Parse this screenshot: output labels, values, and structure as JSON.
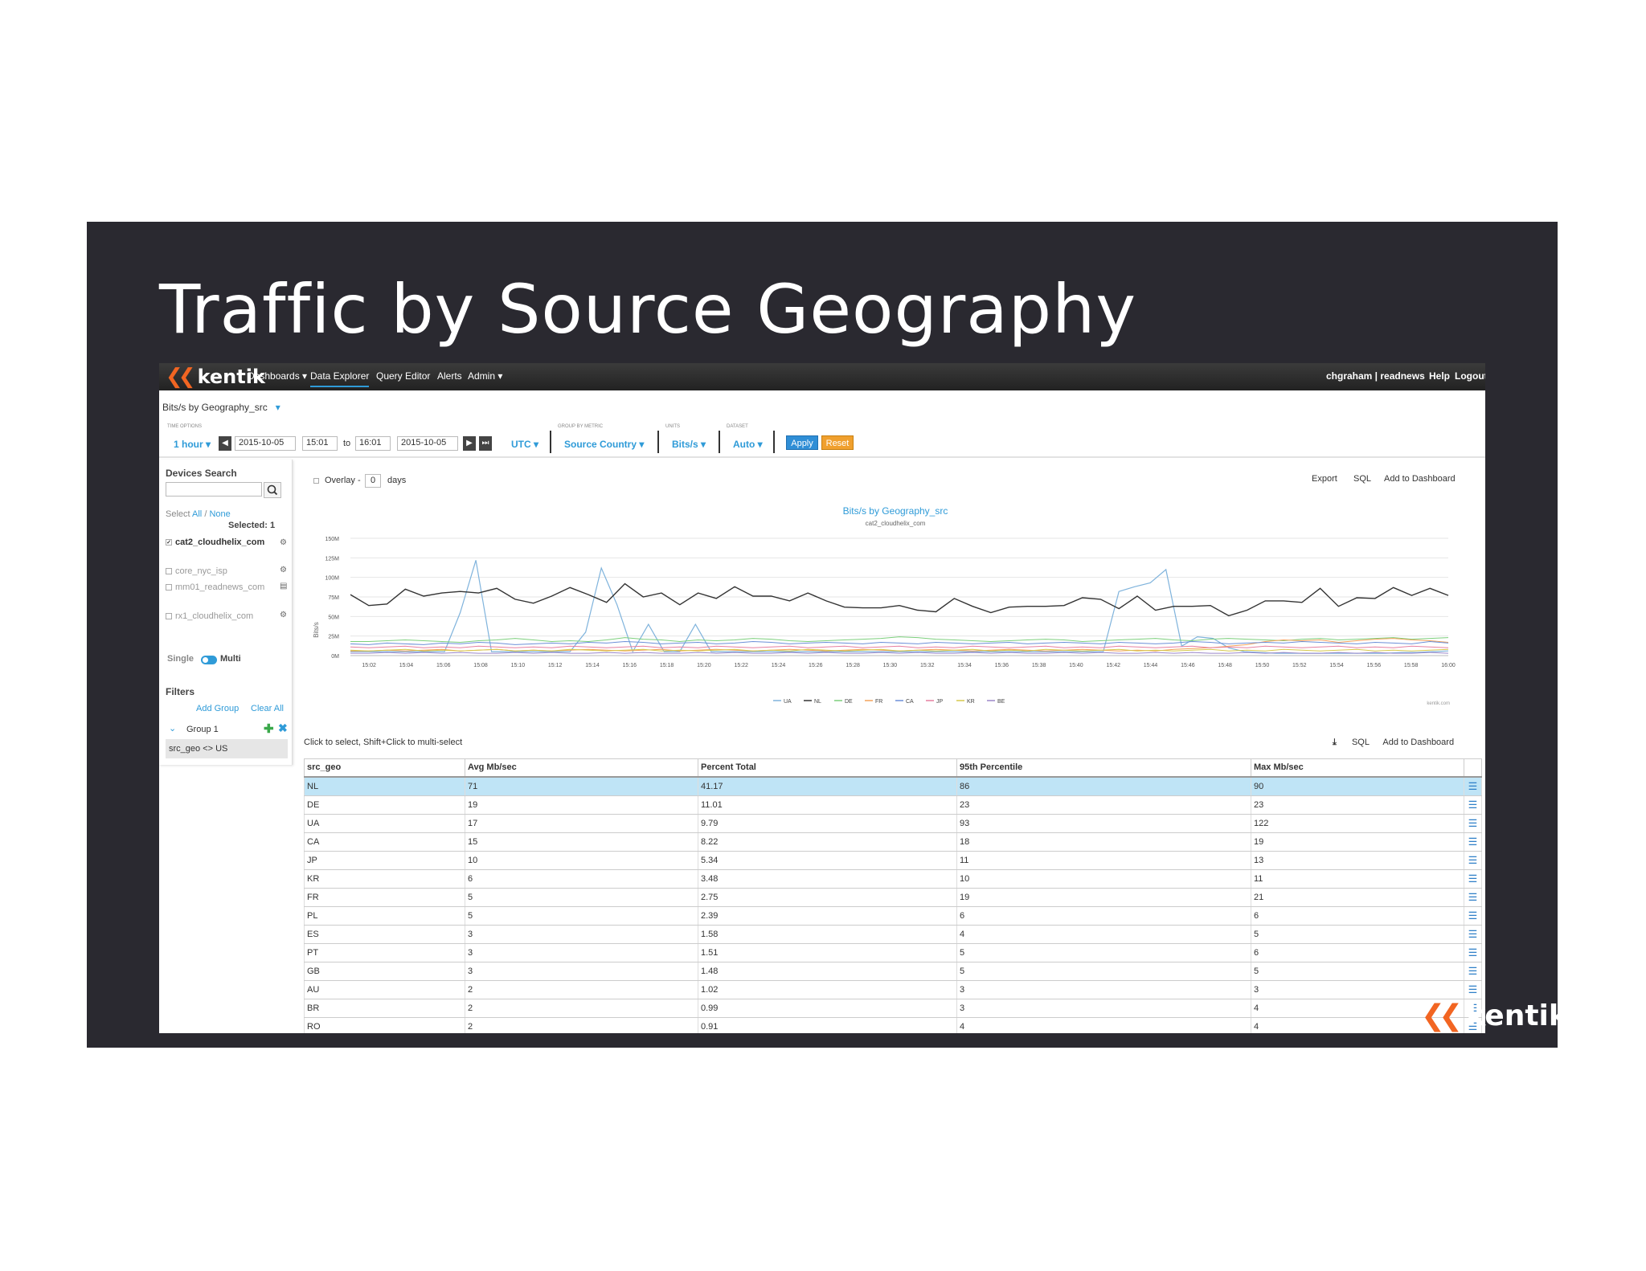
{
  "slide": {
    "title": "Traffic by Source Geography"
  },
  "navbar": {
    "logo": "kentik",
    "items": [
      "Dashboards",
      "Data Explorer",
      "Query Editor",
      "Alerts",
      "Admin"
    ],
    "user": "chgraham | readnews",
    "help": "Help",
    "logout": "Logout"
  },
  "query": {
    "title": "Bits/s by Geography_src",
    "time_options_label": "Time Options",
    "time_range": "1 hour",
    "start_date": "2015-10-05",
    "start_time": "15:01",
    "to_label": "to",
    "end_time": "16:01",
    "end_date": "2015-10-05",
    "timezone": "UTC",
    "group_by_label": "Group by Metric",
    "group_by": "Source Country",
    "units_label": "Units",
    "units": "Bits/s",
    "dataset_label": "Dataset",
    "dataset": "Auto",
    "apply": "Apply",
    "reset": "Reset"
  },
  "sidebar": {
    "devices_heading": "Devices Search",
    "select_label": "Select",
    "select_all": "All",
    "select_sep": "/",
    "select_none": "None",
    "selected": "Selected: 1",
    "devices": [
      {
        "name": "cat2_cloudhelix_com",
        "checked": true
      },
      {
        "name": "core_nyc_isp",
        "checked": false
      },
      {
        "name": "mm01_readnews_com",
        "checked": false
      },
      {
        "name": "rx1_cloudhelix_com",
        "checked": false
      }
    ],
    "mode_single": "Single",
    "mode_multi": "Multi",
    "filters_heading": "Filters",
    "add_group": "Add Group",
    "clear_all": "Clear All",
    "group_name": "Group 1",
    "filter_expr": "src_geo <> US"
  },
  "chart_panel": {
    "overlay_label": "Overlay -",
    "overlay_value": "0",
    "overlay_unit": "days",
    "export": "Export",
    "sql": "SQL",
    "add_to_dashboard": "Add to Dashboard",
    "credit": "kentik.com"
  },
  "chart_data": {
    "type": "line",
    "title": "Bits/s by Geography_src",
    "subtitle": "cat2_cloudhelix_com",
    "ylabel": "Bits/s",
    "xlabel": "",
    "ylim": [
      0,
      150
    ],
    "yticks": [
      0,
      25,
      50,
      75,
      100,
      125,
      150
    ],
    "ytick_labels": [
      "0M",
      "25M",
      "50M",
      "75M",
      "100M",
      "125M",
      "150M"
    ],
    "x_ticks": [
      "15:02",
      "15:04",
      "15:06",
      "15:08",
      "15:10",
      "15:12",
      "15:14",
      "15:16",
      "15:18",
      "15:20",
      "15:22",
      "15:24",
      "15:26",
      "15:28",
      "15:30",
      "15:32",
      "15:34",
      "15:36",
      "15:38",
      "15:40",
      "15:42",
      "15:44",
      "15:46",
      "15:48",
      "15:50",
      "15:52",
      "15:54",
      "15:56",
      "15:58",
      "16:00"
    ],
    "x_start_minute": 1,
    "x_end_minute": 60,
    "legend_position": "bottom-center",
    "series": [
      {
        "name": "UA",
        "color": "#7fb3dc",
        "values": [
          5,
          5,
          5,
          5,
          5,
          5,
          5,
          55,
          122,
          5,
          5,
          5,
          5,
          5,
          5,
          30,
          112,
          65,
          5,
          40,
          5,
          5,
          40,
          5,
          5,
          5,
          5,
          5,
          5,
          5,
          5,
          5,
          5,
          5,
          5,
          5,
          5,
          5,
          5,
          5,
          5,
          5,
          5,
          5,
          5,
          5,
          5,
          5,
          5,
          82,
          88,
          93,
          110,
          12,
          24,
          22,
          10,
          5,
          4,
          3,
          3,
          3,
          3,
          3,
          3,
          3,
          3,
          4,
          4,
          5,
          6
        ]
      },
      {
        "name": "NL",
        "color": "#333333",
        "values": [
          78,
          64,
          66,
          85,
          76,
          80,
          82,
          80,
          86,
          72,
          67,
          76,
          87,
          78,
          68,
          92,
          75,
          80,
          65,
          80,
          73,
          88,
          76,
          76,
          70,
          80,
          70,
          62,
          61,
          61,
          64,
          58,
          56,
          73,
          63,
          55,
          62,
          63,
          63,
          64,
          74,
          72,
          60,
          76,
          58,
          63,
          63,
          64,
          51,
          58,
          70,
          70,
          68,
          86,
          63,
          74,
          73,
          87,
          77,
          86,
          77
        ]
      },
      {
        "name": "DE",
        "color": "#7ccf7c",
        "values": [
          18,
          18,
          19,
          20,
          19,
          18,
          17,
          19,
          20,
          22,
          20,
          18,
          19,
          18,
          20,
          23,
          21,
          20,
          18,
          20,
          19,
          20,
          22,
          21,
          19,
          18,
          19,
          20,
          21,
          22,
          24,
          23,
          21,
          20,
          19,
          18,
          19,
          20,
          21,
          20,
          18,
          19,
          20,
          21,
          22,
          20,
          19,
          21,
          22,
          21,
          20,
          19,
          21,
          22,
          20,
          21,
          22,
          23,
          21,
          22,
          23
        ]
      },
      {
        "name": "FR",
        "color": "#f3a25a",
        "values": [
          6,
          6,
          7,
          6,
          7,
          8,
          6,
          7,
          8,
          6,
          7,
          6,
          7,
          8,
          7,
          6,
          7,
          8,
          6,
          7,
          8,
          7,
          6,
          7,
          8,
          7,
          6,
          7,
          8,
          7,
          6,
          7,
          8,
          7,
          6,
          7,
          8,
          7,
          6,
          7,
          8,
          7,
          6,
          7,
          6,
          8,
          9,
          10,
          12,
          14,
          18,
          20,
          19,
          20,
          17,
          19,
          21,
          22,
          20,
          19,
          17
        ]
      },
      {
        "name": "CA",
        "color": "#6c8fd8",
        "values": [
          15,
          14,
          16,
          15,
          14,
          16,
          15,
          17,
          16,
          14,
          15,
          16,
          15,
          17,
          16,
          18,
          17,
          15,
          16,
          17,
          15,
          16,
          18,
          17,
          15,
          16,
          17,
          16,
          15,
          17,
          16,
          15,
          17,
          16,
          15,
          16,
          17,
          15,
          16,
          17,
          16,
          15,
          17,
          16,
          15,
          16,
          18,
          17,
          15,
          16,
          17,
          16,
          18,
          17,
          16,
          15,
          17,
          16,
          15,
          18,
          16
        ]
      },
      {
        "name": "JP",
        "color": "#e67fa0",
        "values": [
          11,
          10,
          11,
          12,
          10,
          11,
          10,
          12,
          11,
          10,
          11,
          10,
          12,
          11,
          10,
          11,
          12,
          10,
          11,
          10,
          12,
          11,
          10,
          11,
          12,
          10,
          11,
          12,
          10,
          11,
          12,
          10,
          11,
          10,
          12,
          11,
          10,
          11,
          12,
          10,
          11,
          10,
          12,
          11,
          10,
          11,
          12,
          10,
          11,
          10,
          12,
          11,
          10,
          11,
          12,
          10,
          11,
          10,
          12,
          11,
          10
        ]
      },
      {
        "name": "KR",
        "color": "#d6c94c",
        "values": [
          7,
          6,
          7,
          8,
          6,
          7,
          6,
          7,
          8,
          6,
          7,
          6,
          8,
          7,
          6,
          7,
          8,
          6,
          7,
          6,
          7,
          8,
          6,
          7,
          6,
          8,
          7,
          6,
          7,
          8,
          6,
          7,
          6,
          7,
          8,
          6,
          7,
          6,
          8,
          7,
          6,
          7,
          8,
          6,
          7,
          6,
          7,
          8,
          6,
          7,
          6,
          8,
          7,
          6,
          7,
          8,
          6,
          7,
          6,
          7,
          8
        ]
      },
      {
        "name": "BE",
        "color": "#9a87c9",
        "values": [
          3,
          3,
          4,
          3,
          4,
          3,
          4,
          3,
          3,
          4,
          3,
          4,
          3,
          3,
          4,
          3,
          4,
          3,
          3,
          4,
          3,
          4,
          3,
          3,
          4,
          3,
          4,
          3,
          3,
          4,
          3,
          4,
          3,
          3,
          4,
          3,
          4,
          3,
          3,
          4,
          3,
          4,
          3,
          3,
          4,
          3,
          4,
          3,
          3,
          4,
          3,
          4,
          3,
          3,
          4,
          3,
          4,
          3,
          3,
          4,
          3
        ]
      }
    ]
  },
  "table": {
    "caption": "Click to select, Shift+Click to multi-select",
    "download_icon": "download-icon",
    "sql": "SQL",
    "add_to_dashboard": "Add to Dashboard",
    "columns": [
      "src_geo",
      "Avg Mb/sec",
      "Percent Total",
      "95th Percentile",
      "Max Mb/sec"
    ],
    "rows": [
      [
        "NL",
        "71",
        "41.17",
        "86",
        "90"
      ],
      [
        "DE",
        "19",
        "11.01",
        "23",
        "23"
      ],
      [
        "UA",
        "17",
        "9.79",
        "93",
        "122"
      ],
      [
        "CA",
        "15",
        "8.22",
        "18",
        "19"
      ],
      [
        "JP",
        "10",
        "5.34",
        "11",
        "13"
      ],
      [
        "KR",
        "6",
        "3.48",
        "10",
        "11"
      ],
      [
        "FR",
        "5",
        "2.75",
        "19",
        "21"
      ],
      [
        "PL",
        "5",
        "2.39",
        "6",
        "6"
      ],
      [
        "ES",
        "3",
        "1.58",
        "4",
        "5"
      ],
      [
        "PT",
        "3",
        "1.51",
        "5",
        "6"
      ],
      [
        "GB",
        "3",
        "1.48",
        "5",
        "5"
      ],
      [
        "AU",
        "2",
        "1.02",
        "3",
        "3"
      ],
      [
        "BR",
        "2",
        "0.99",
        "3",
        "4"
      ],
      [
        "RO",
        "2",
        "0.91",
        "4",
        "4"
      ]
    ],
    "selected_row": 0
  },
  "watermark": {
    "logo": "kentik"
  }
}
